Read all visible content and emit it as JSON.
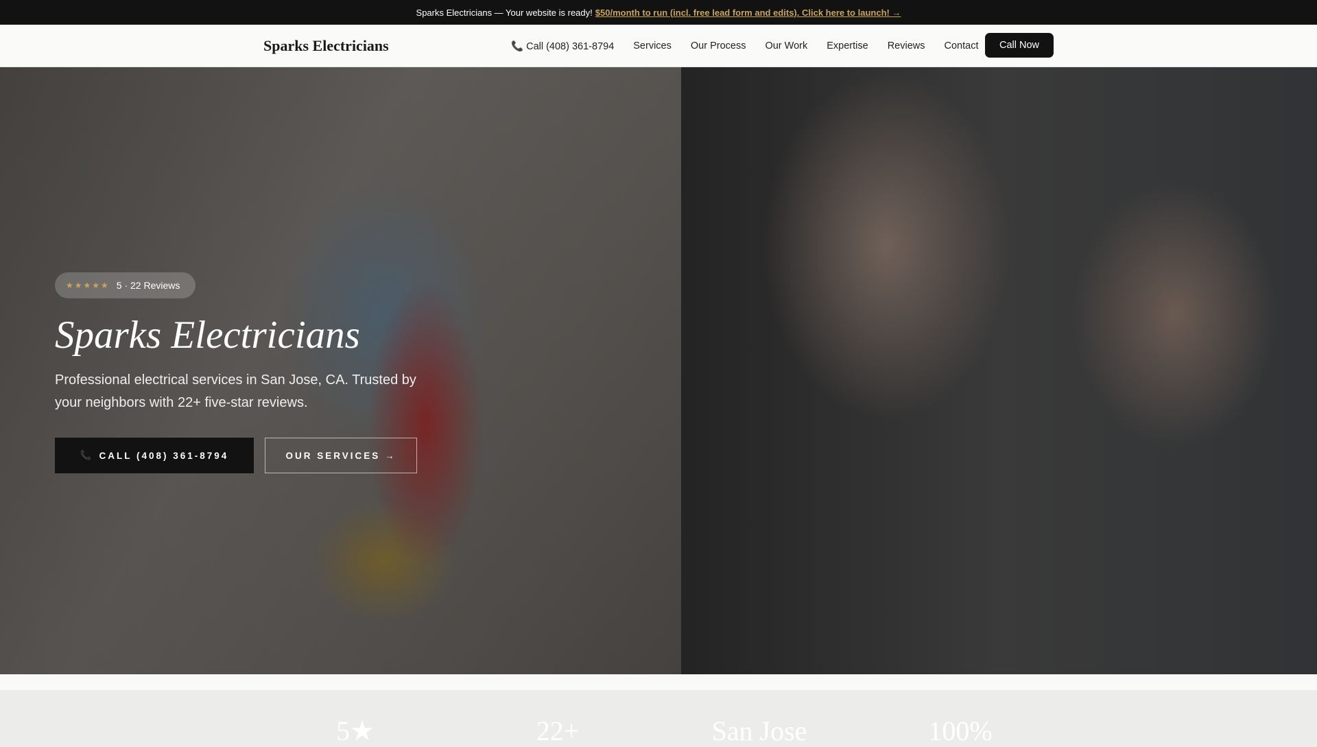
{
  "topbar": {
    "text": "Sparks Electricians — Your website is ready!",
    "link": "$50/month to run (incl. free lead form and edits). Click here to launch! →"
  },
  "nav": {
    "logo": "Sparks Electricians",
    "phone": "Call (408) 361-8794",
    "links": [
      "Services",
      "Our Process",
      "Our Work",
      "Expertise",
      "Reviews",
      "Contact"
    ],
    "cta": "Call Now"
  },
  "hero": {
    "rating": "5 · 22 Reviews",
    "stars": "★★★★★",
    "title": "Sparks Electricians",
    "subtitle": "Professional electrical services in San Jose, CA. Trusted by your neighbors with 22+ five-star reviews.",
    "call_button": "CALL (408) 361-8794",
    "services_button": "OUR SERVICES →"
  },
  "stats": [
    "5★",
    "22+",
    "San Jose",
    "100%"
  ]
}
